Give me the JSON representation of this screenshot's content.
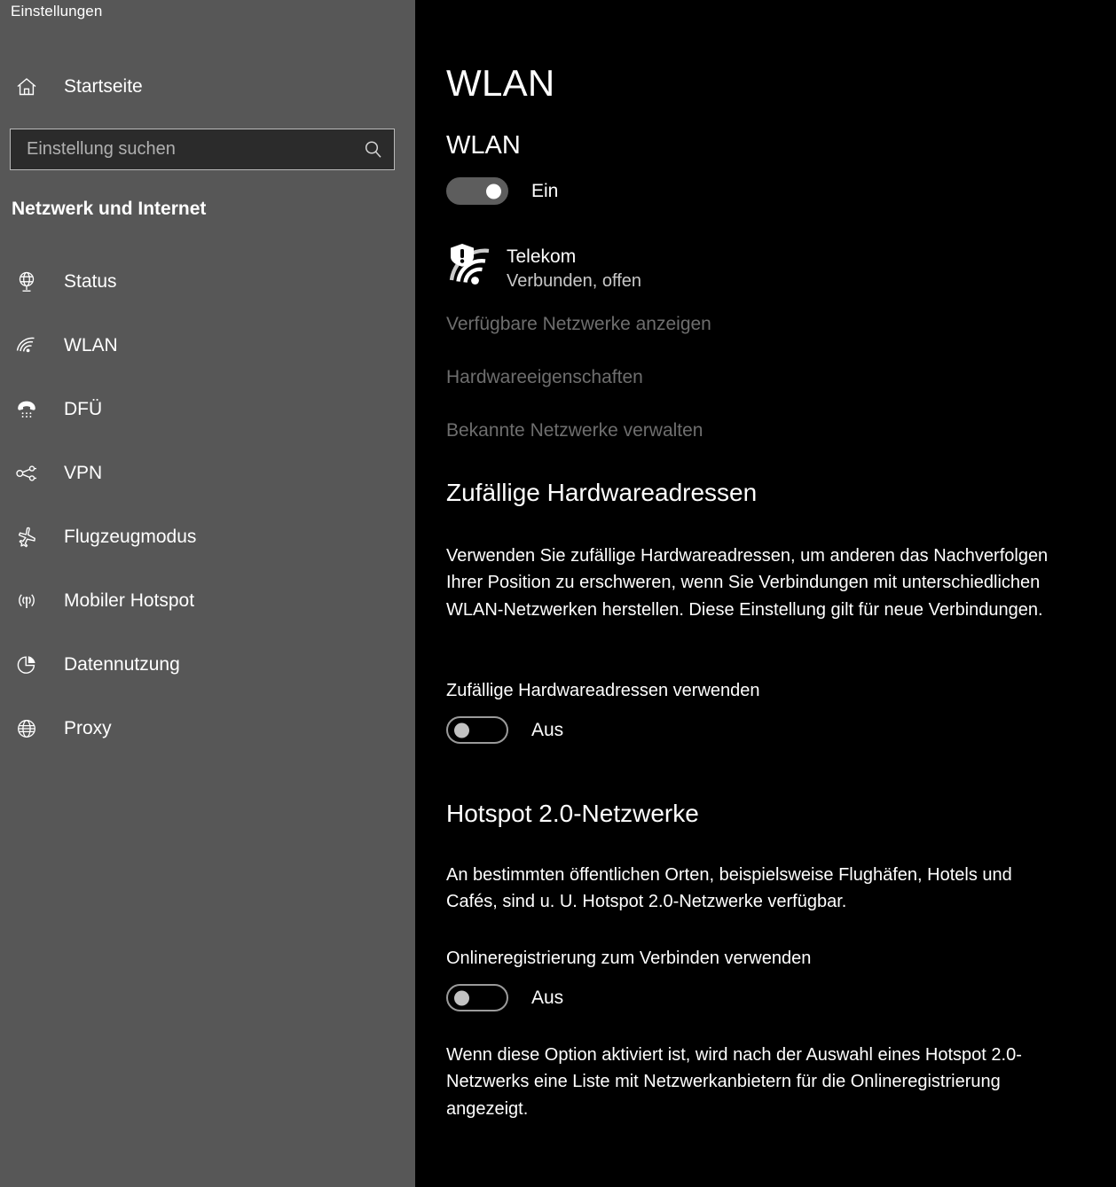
{
  "app": {
    "title": "Einstellungen"
  },
  "sidebar": {
    "home": {
      "label": "Startseite",
      "icon": "home-icon"
    },
    "search": {
      "placeholder": "Einstellung suchen",
      "value": "",
      "icon": "search-icon"
    },
    "category_heading": "Netzwerk und Internet",
    "items": [
      {
        "label": "Status",
        "icon": "globe-network-icon"
      },
      {
        "label": "WLAN",
        "icon": "wifi-icon"
      },
      {
        "label": "DFÜ",
        "icon": "phone-dialup-icon"
      },
      {
        "label": "VPN",
        "icon": "vpn-key-icon"
      },
      {
        "label": "Flugzeugmodus",
        "icon": "airplane-icon"
      },
      {
        "label": "Mobiler Hotspot",
        "icon": "hotspot-broadcast-icon"
      },
      {
        "label": "Datennutzung",
        "icon": "pie-chart-icon"
      },
      {
        "label": "Proxy",
        "icon": "globe-icon"
      }
    ]
  },
  "main": {
    "page_title": "WLAN",
    "wlan": {
      "heading": "WLAN",
      "toggle_state": "Ein",
      "toggle_on": true,
      "network": {
        "name": "Telekom",
        "status": "Verbunden, offen",
        "icon": "wifi-warning-shield-icon"
      },
      "links": [
        "Verfügbare Netzwerke anzeigen",
        "Hardwareeigenschaften",
        "Bekannte Netzwerke verwalten"
      ]
    },
    "random_hw": {
      "heading": "Zufällige Hardwareadressen",
      "description": "Verwenden Sie zufällige Hardwareadressen, um anderen das Nachverfolgen Ihrer Position zu erschweren, wenn Sie Verbindungen mit unterschiedlichen WLAN-Netzwerken herstellen. Diese Einstellung gilt für neue Verbindungen.",
      "setting_label": "Zufällige Hardwareadressen verwenden",
      "toggle_state": "Aus",
      "toggle_on": false
    },
    "hotspot20": {
      "heading": "Hotspot 2.0-Netzwerke",
      "description": "An bestimmten öffentlichen Orten, beispielsweise Flughäfen, Hotels und Cafés, sind u. U. Hotspot 2.0-Netzwerke verfügbar.",
      "setting_label": "Onlineregistrierung zum Verbinden verwenden",
      "toggle_state": "Aus",
      "toggle_on": false,
      "footnote": "Wenn diese Option aktiviert ist, wird nach der Auswahl eines Hotspot 2.0-Netzwerks eine Liste mit Netzwerkanbietern für die Onlineregistrierung angezeigt."
    }
  },
  "colors": {
    "sidebar_bg": "#575757",
    "main_bg": "#000000",
    "text_primary": "#ffffff",
    "text_secondary": "#c8c8c8",
    "text_disabled": "#6e6e6e",
    "toggle_on_track": "#5d5d5d",
    "search_bg": "#2b2b2b",
    "search_border": "#b9b9b9"
  }
}
